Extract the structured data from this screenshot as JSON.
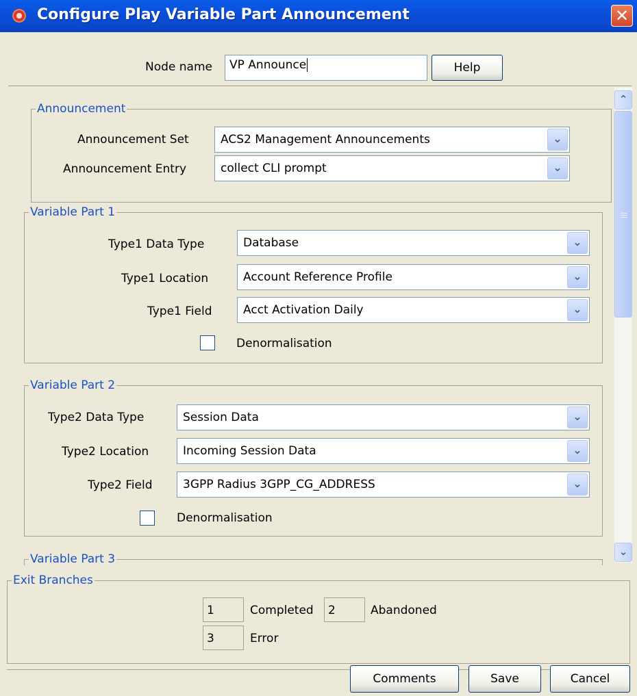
{
  "window": {
    "title": "Configure Play Variable Part Announcement",
    "close_icon": "close-icon"
  },
  "node": {
    "label": "Node name",
    "value": "VP Announce",
    "help_label": "Help"
  },
  "announcement": {
    "legend": "Announcement",
    "set_label": "Announcement Set",
    "set_value": "ACS2 Management Announcements",
    "entry_label": "Announcement Entry",
    "entry_value": "collect CLI prompt"
  },
  "variable_part_1": {
    "legend": "Variable Part 1",
    "data_type_label": "Type1 Data Type",
    "data_type_value": "Database",
    "location_label": "Type1 Location",
    "location_value": "Account Reference Profile",
    "field_label": "Type1 Field",
    "field_value": "Acct Activation Daily",
    "denorm_label": "Denormalisation",
    "denorm_checked": false
  },
  "variable_part_2": {
    "legend": "Variable Part 2",
    "data_type_label": "Type2 Data Type",
    "data_type_value": "Session Data",
    "location_label": "Type2 Location",
    "location_value": "Incoming Session Data",
    "field_label": "Type2 Field",
    "field_value": "3GPP Radius 3GPP_CG_ADDRESS",
    "denorm_label": "Denormalisation",
    "denorm_checked": false
  },
  "variable_part_3": {
    "legend": "Variable Part 3"
  },
  "exit_branches": {
    "legend": "Exit Branches",
    "items": [
      {
        "number": "1",
        "label": "Completed"
      },
      {
        "number": "2",
        "label": "Abandoned"
      },
      {
        "number": "3",
        "label": "Error"
      }
    ]
  },
  "footer": {
    "comments_label": "Comments",
    "save_label": "Save",
    "cancel_label": "Cancel"
  },
  "colors": {
    "titlebar": "#0a4fd9",
    "dialog_bg": "#ece9d8",
    "legend_text": "#1a50c8"
  }
}
